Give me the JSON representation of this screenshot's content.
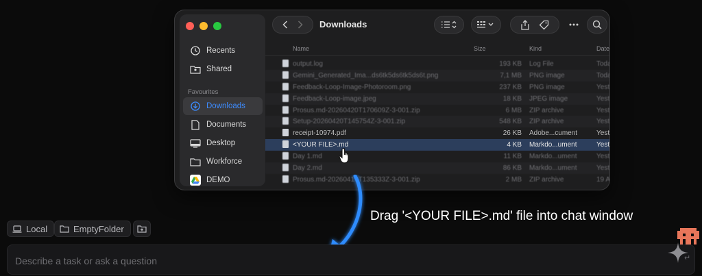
{
  "finder": {
    "title": "Downloads",
    "sidebar": {
      "items_top": [
        {
          "label": "Recents",
          "icon": "clock-icon"
        },
        {
          "label": "Shared",
          "icon": "shared-folder-icon"
        }
      ],
      "section_label": "Favourites",
      "items_fav": [
        {
          "label": "Downloads",
          "icon": "download-circle-icon",
          "active": true
        },
        {
          "label": "Documents",
          "icon": "document-icon"
        },
        {
          "label": "Desktop",
          "icon": "desktop-icon"
        },
        {
          "label": "Workforce",
          "icon": "folder-icon"
        },
        {
          "label": "DEMO",
          "icon": "google-drive-icon"
        }
      ]
    },
    "columns": {
      "name": "Name",
      "size": "Size",
      "kind": "Kind",
      "date": "Date"
    },
    "files": [
      {
        "name": "output.log",
        "size": "193 KB",
        "kind": "Log File",
        "date": "Toda"
      },
      {
        "name": "Gemini_Generated_Ima...ds6tk5ds6tk5ds6t.png",
        "size": "7,1 MB",
        "kind": "PNG image",
        "date": "Toda"
      },
      {
        "name": "Feedback-Loop-Image-Photoroom.png",
        "size": "237 KB",
        "kind": "PNG image",
        "date": "Yest"
      },
      {
        "name": "Feedback-Loop-image.jpeg",
        "size": "18 KB",
        "kind": "JPEG image",
        "date": "Yest"
      },
      {
        "name": "Prosus.md-20260420T170609Z-3-001.zip",
        "size": "6 MB",
        "kind": "ZIP archive",
        "date": "Yest"
      },
      {
        "name": "Setup-20260420T145754Z-3-001.zip",
        "size": "548 KB",
        "kind": "ZIP archive",
        "date": "Yest"
      },
      {
        "name": "receipt-10974.pdf",
        "size": "26 KB",
        "kind": "Adobe...cument",
        "date": "Yest"
      },
      {
        "name": "<YOUR FILE>.md",
        "size": "4 KB",
        "kind": "Markdo...ument",
        "date": "Yest",
        "selected": true
      },
      {
        "name": "Day 1.md",
        "size": "11 KB",
        "kind": "Markdo...ument",
        "date": "Yest"
      },
      {
        "name": "Day 2.md",
        "size": "86 KB",
        "kind": "Markdo...ument",
        "date": "Yest"
      },
      {
        "name": "Prosus.md-20260419T135333Z-3-001.zip",
        "size": "2 MB",
        "kind": "ZIP archive",
        "date": "19 A"
      }
    ]
  },
  "instruction": "Drag '<YOUR FILE>.md' file into chat window",
  "chips": {
    "local": "Local",
    "folder": "EmptyFolder"
  },
  "chat": {
    "placeholder": "Describe a task or ask a question"
  },
  "colors": {
    "accent": "#3d8cff",
    "arrow": "#2f8cff",
    "selection": "#2c3e5c"
  }
}
